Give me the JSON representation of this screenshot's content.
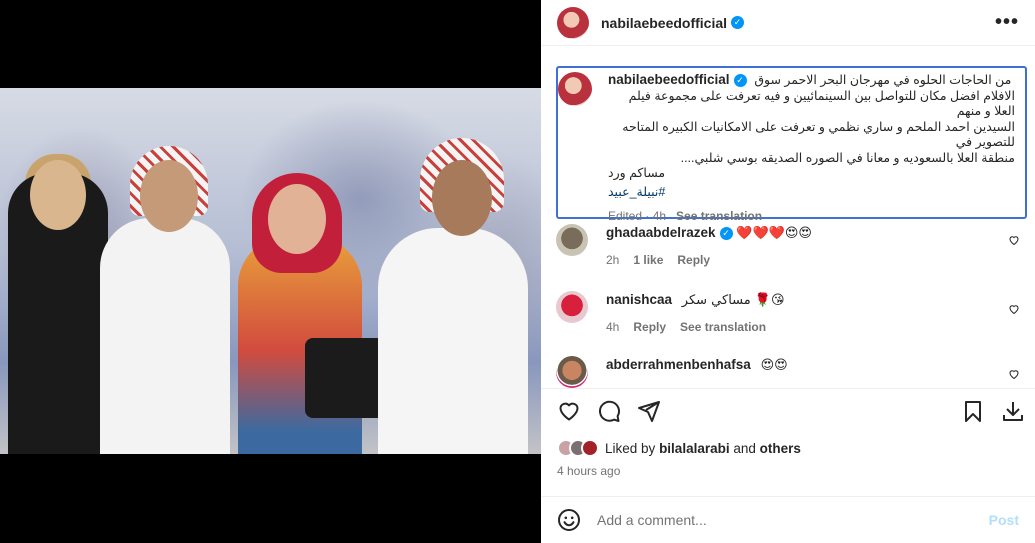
{
  "post": {
    "username": "nabilaebeedofficial",
    "verified_mark": "✓",
    "more_glyph": "•••"
  },
  "caption": {
    "username": "nabilaebeedofficial",
    "lines": [
      "من الحاجات الحلوه في مهرجان البحر الاحمر سوق",
      "الافلام افضل مكان للتواصل بين السينمائيين و فيه تعرفت على مجموعة فيلم العلا و منهم",
      "السيدين احمد الملحم و ساري نظمي و تعرفت على الامكانيات الكبيره المتاحه للتصوير في",
      "منطقة العلا بالسعوديه و معانا في الصوره الصديقه بوسي شلبي....",
      "مساكم ورد"
    ],
    "hashtag": "#نبيلة_عبيد",
    "edited": "Edited · 4h",
    "see_translation": "See translation"
  },
  "comments": [
    {
      "username": "ghadaabdelrazek",
      "verified": true,
      "text": "❤️❤️❤️😍😍",
      "time": "2h",
      "likes": "1 like",
      "reply": "Reply"
    },
    {
      "username": "nanishcaa",
      "verified": false,
      "text": "مساكي سكر 🌹😘",
      "time": "4h",
      "reply": "Reply",
      "see_translation": "See translation"
    },
    {
      "username": "abderrahmenbenhafsa",
      "verified": false,
      "text": "😍😍"
    }
  ],
  "likes": {
    "prefix": "Liked by",
    "user": "bilalalarabi",
    "middle": "and",
    "others": "others"
  },
  "timestamp": "4 hours ago",
  "add_comment": {
    "placeholder": "Add a comment...",
    "post_label": "Post"
  },
  "icons": {
    "like": "heart-icon",
    "comment": "comment-icon",
    "share": "share-icon",
    "save": "bookmark-icon",
    "download": "download-icon",
    "emoji": "smiley-icon"
  },
  "colors": {
    "accent": "#0095f6",
    "caption_border": "#3f6fd8",
    "hashtag": "#00376b",
    "muted": "#737373"
  }
}
